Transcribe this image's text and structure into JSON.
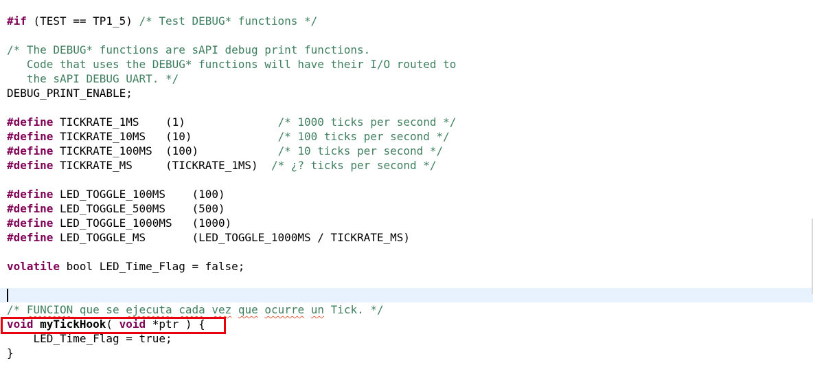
{
  "lines": {
    "l1": {
      "kw": "#if",
      "rest": " (TEST == TP1_5) ",
      "comment": "/* Test DEBUG* functions */"
    },
    "l3": "/* The DEBUG* functions are sAPI debug print functions.",
    "l4": "   Code that uses the DEBUG* functions will have their I/O routed to",
    "l5": "   the sAPI DEBUG UART. */",
    "l6": "DEBUG_PRINT_ENABLE;",
    "d1": {
      "kw": "#define",
      "rest": " TICKRATE_1MS    (1)              ",
      "comment": "/* 1000 ticks per second */"
    },
    "d2": {
      "kw": "#define",
      "rest": " TICKRATE_10MS   (10)             ",
      "comment": "/* 100 ticks per second */"
    },
    "d3": {
      "kw": "#define",
      "rest": " TICKRATE_100MS  (100)            ",
      "comment": "/* 10 ticks per second */"
    },
    "d4": {
      "kw": "#define",
      "rest": " TICKRATE_MS     (TICKRATE_1MS)  ",
      "comment": "/* ¿? ticks per second */"
    },
    "e1": {
      "kw": "#define",
      "rest": " LED_TOGGLE_100MS    (100)"
    },
    "e2": {
      "kw": "#define",
      "rest": " LED_TOGGLE_500MS    (500)"
    },
    "e3": {
      "kw": "#define",
      "rest": " LED_TOGGLE_1000MS   (1000)"
    },
    "e4": {
      "kw": "#define",
      "rest": " LED_TOGGLE_MS       (LED_TOGGLE_1000MS / TICKRATE_MS)"
    },
    "v1": {
      "kw": "volatile",
      "rest": " bool LED_Time_Flag = false;"
    },
    "c1": {
      "p1": "/* ",
      "w1": "FUNCION",
      "p2": " que se ",
      "w2": "ejecuta",
      "p3": " ",
      "w3": "cada",
      "p4": " ",
      "w4": "vez",
      "p5": " ",
      "w5": "que",
      "p6": " ",
      "w6": "ocurre",
      "p7": " ",
      "w7": "un",
      "p8": " Tick. */"
    },
    "f1": {
      "kw1": "void",
      "sp": " ",
      "fn": "myTickHook",
      "p1": "( ",
      "kw2": "void",
      "p2": " *ptr ) {"
    },
    "f2": "    LED_Time_Flag = true;",
    "f3": "}"
  }
}
